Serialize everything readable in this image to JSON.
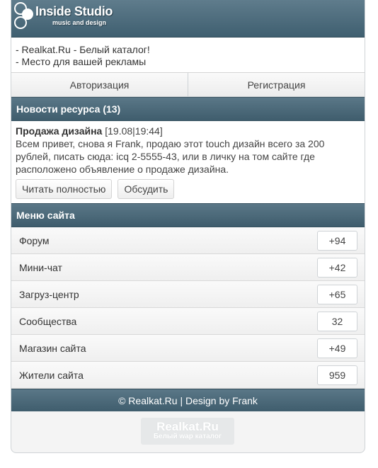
{
  "brand": {
    "title": "Inside Studio",
    "subtitle": "music and design"
  },
  "ads": [
    "- Realkat.Ru - Белый каталог!",
    "- Место для вашей рекламы"
  ],
  "auth": {
    "login": "Авторизация",
    "register": "Регистрация"
  },
  "news_section": {
    "title": "Новости ресурса (13)"
  },
  "news": {
    "title": "Продажа дизайна",
    "date": " [19.08|19:44]",
    "body": "Всем привет, снова я Frank, продаю этот touch дизайн всего за 200 рублей, писать сюда: icq 2-5555-43, или в личку на том сайте где расположено объявление о продаже дизайна.",
    "read_more": "Читать полностью",
    "discuss": "Обсудить"
  },
  "menu_section": {
    "title": "Меню сайта"
  },
  "menu": [
    {
      "label": "Форум",
      "count": "+94"
    },
    {
      "label": "Мини-чат",
      "count": "+42"
    },
    {
      "label": "Загруз-центр",
      "count": "+65"
    },
    {
      "label": "Сообщества",
      "count": "32"
    },
    {
      "label": "Магазин сайта",
      "count": "+49"
    },
    {
      "label": "Жители сайта",
      "count": "959"
    }
  ],
  "footer": {
    "text": "© Realkat.Ru | Design by Frank"
  },
  "counter": {
    "title": "Realkat.Ru",
    "subtitle": "Белый wap каталог"
  }
}
